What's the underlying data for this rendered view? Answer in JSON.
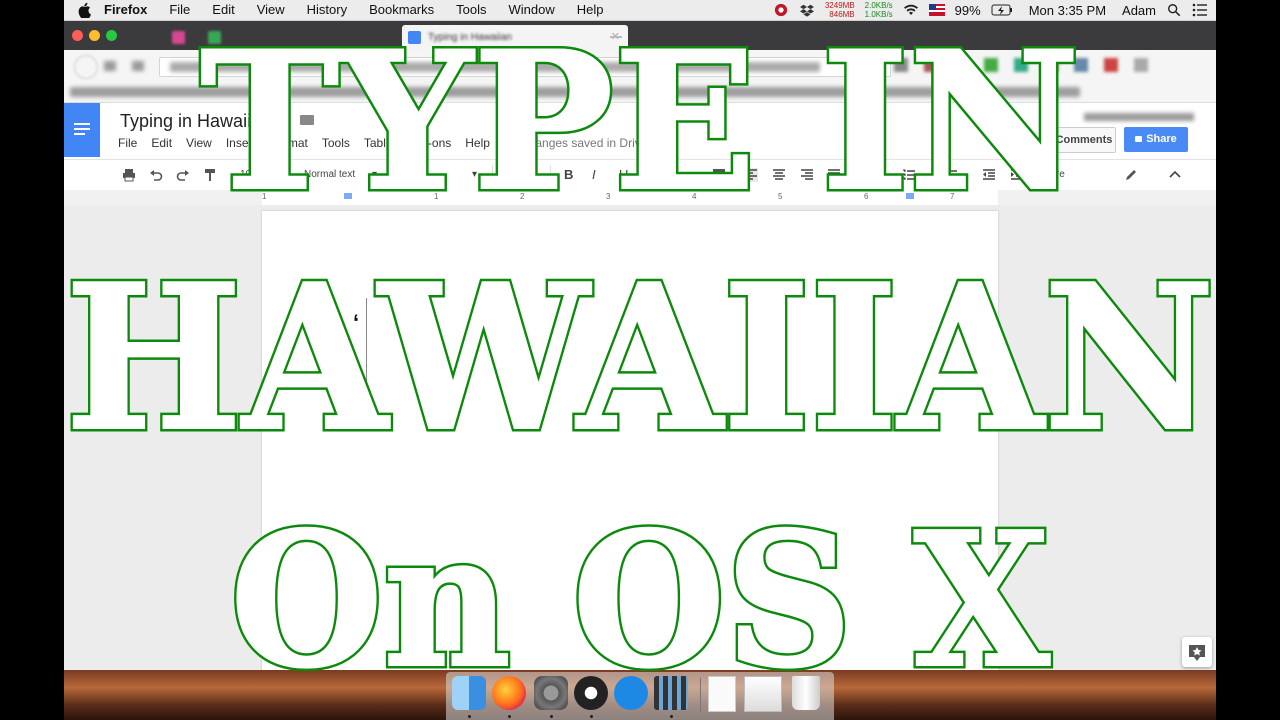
{
  "menubar": {
    "items": [
      "Firefox",
      "File",
      "Edit",
      "View",
      "History",
      "Bookmarks",
      "Tools",
      "Window",
      "Help"
    ],
    "mem_top": "3249MB",
    "mem_bottom": "846MB",
    "net_up": "2.0KB/s",
    "net_down": "1.0KB/s",
    "battery": "99%",
    "clock": "Mon 3:35 PM",
    "user": "Adam"
  },
  "docs": {
    "title": "Typing in Hawaiian",
    "menu": [
      "File",
      "Edit",
      "View",
      "Insert",
      "Format",
      "Tools",
      "Table",
      "Add-ons",
      "Help"
    ],
    "saved_status": "All changes saved in Drive",
    "comments_label": "Comments",
    "share_label": "Share"
  },
  "toolbar": {
    "zoom": "100%",
    "style": "Normal text",
    "font": "Arial",
    "font_size": "60",
    "more": "More"
  },
  "ruler": [
    "1",
    "1",
    "2",
    "3",
    "4",
    "5",
    "6",
    "7"
  ],
  "document": {
    "content": "‘"
  },
  "overlay": {
    "line1": "TYPE IN",
    "line2": "HAWAIIAN",
    "line3": "On OS X",
    "color": "#0c8a0c"
  },
  "icons": {
    "apple": "apple-icon",
    "wifi": "wifi-icon",
    "search": "search-icon"
  }
}
